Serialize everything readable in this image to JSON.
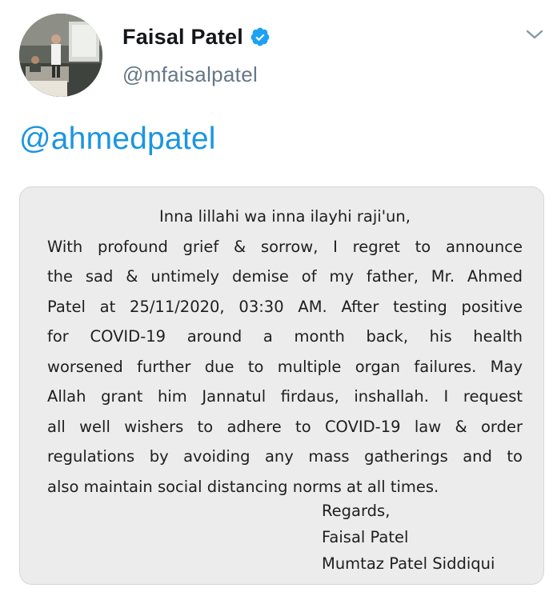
{
  "tweet": {
    "author": {
      "display_name": "Faisal Patel",
      "handle": "@mfaisalpatel",
      "verified": true,
      "avatar_icon": "speaker-presentation-photo"
    },
    "menu_icon": "chevron-down-icon",
    "mention": "@ahmedpatel",
    "colors": {
      "accent": "#1b95e0",
      "verified_badge": "#1da1f2",
      "secondary_text": "#657786",
      "card_background": "#ececec"
    },
    "image_text": {
      "lines": [
        "Inna lillahi wa inna ilayhi raji'un,",
        "With profound grief & sorrow, I regret to announce",
        "the sad & untimely demise of my father, Mr. Ahmed",
        "Patel at 25/11/2020, 03:30 AM. After testing positive",
        "for COVID-19 around a month back, his health",
        "worsened further due to multiple organ failures. May",
        "Allah grant him Jannatul firdaus, inshallah. I request",
        "all well wishers to adhere to COVID-19 law & order",
        "regulations by avoiding any mass gatherings and to",
        "also maintain social distancing norms at all times."
      ],
      "signature": [
        "Regards,",
        "Faisal Patel",
        "Mumtaz Patel Siddiqui"
      ]
    }
  }
}
